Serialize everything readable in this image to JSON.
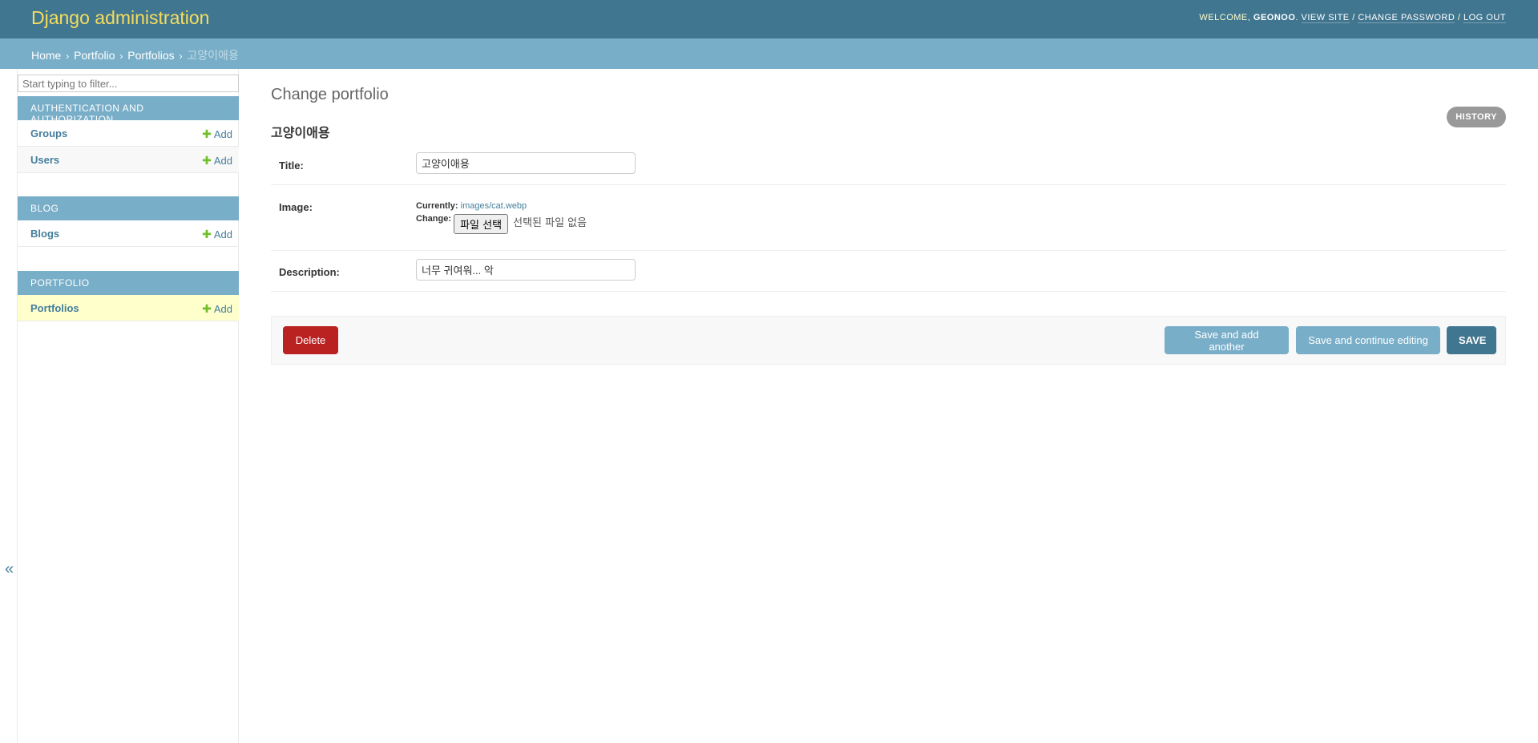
{
  "header": {
    "branding": "Django administration",
    "welcome": "WELCOME,",
    "username": "GEONOO",
    "view_site": "VIEW SITE",
    "change_password": "CHANGE PASSWORD",
    "log_out": "LOG OUT"
  },
  "breadcrumbs": {
    "home": "Home",
    "app": "Portfolio",
    "model": "Portfolios",
    "current": "고양이애용"
  },
  "sidebar": {
    "filter_placeholder": "Start typing to filter...",
    "toggle": "«",
    "add_label": "Add",
    "modules": [
      {
        "caption": "AUTHENTICATION AND AUTHORIZATION",
        "models": [
          "Groups",
          "Users"
        ]
      },
      {
        "caption": "BLOG",
        "models": [
          "Blogs"
        ]
      },
      {
        "caption": "PORTFOLIO",
        "models": [
          "Portfolios"
        ]
      }
    ]
  },
  "content": {
    "title": "Change portfolio",
    "object_title": "고양이애용",
    "history": "HISTORY",
    "fields": {
      "title_label": "Title:",
      "title_value": "고양이애용",
      "image_label": "Image:",
      "currently_label": "Currently:",
      "currently_value": "images/cat.webp",
      "change_label": "Change:",
      "file_button": "파일 선택",
      "file_none": "선택된 파일 없음",
      "description_label": "Description:",
      "description_value": "너무 귀여워... 악"
    },
    "buttons": {
      "delete": "Delete",
      "save_add_another": "Save and add another",
      "save_continue": "Save and continue editing",
      "save": "SAVE"
    }
  },
  "colors": {
    "header_bg": "#417690",
    "branding": "#f5dd5d",
    "breadcrumb_bg": "#79aec8",
    "delete": "#ba2121",
    "current_row": "#ffffcc"
  }
}
